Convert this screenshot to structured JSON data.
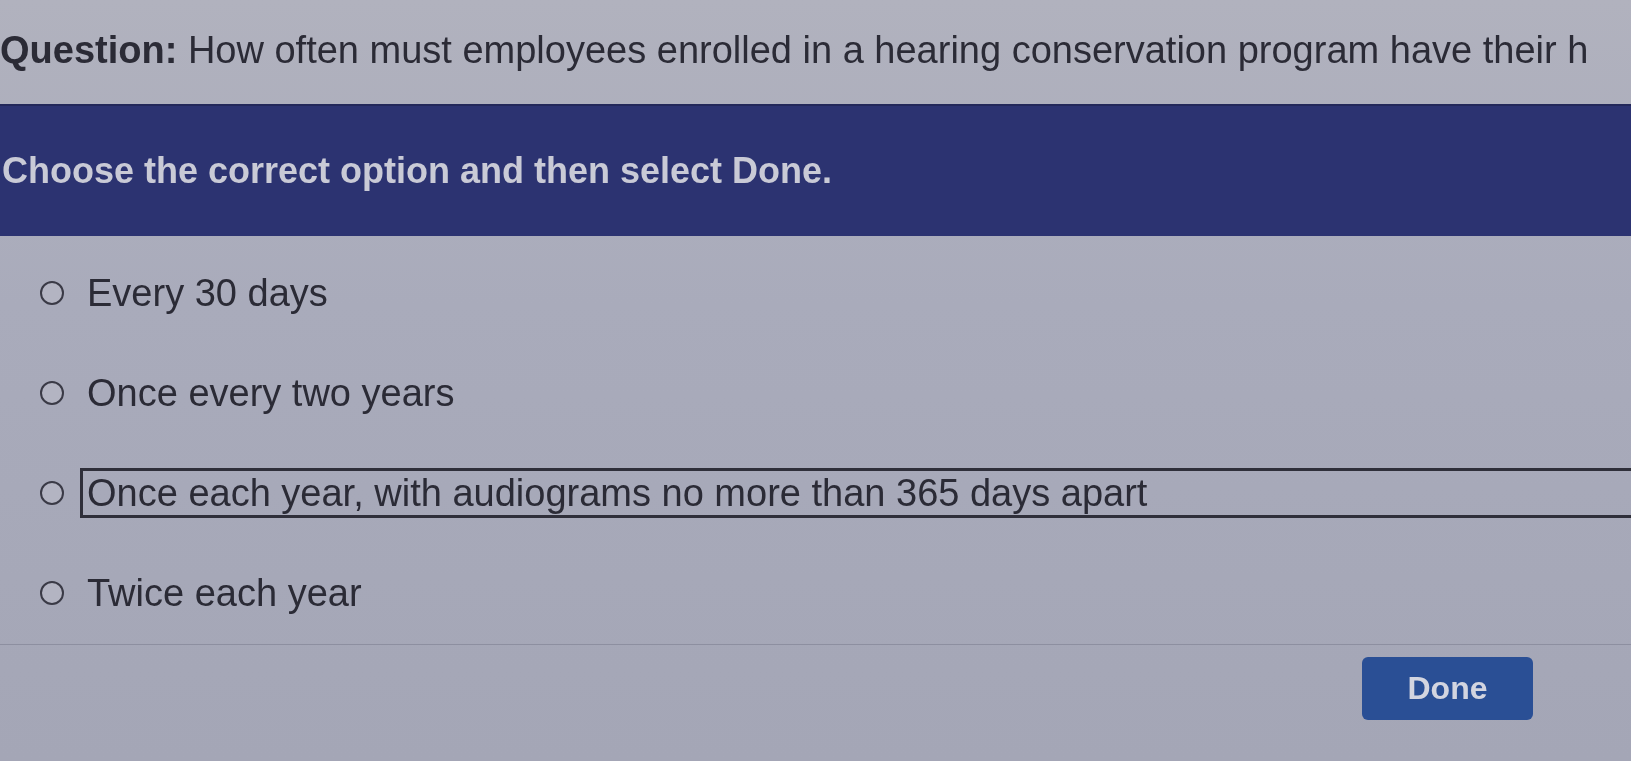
{
  "question": {
    "text": "**Question:** How often must employees enrolled in a hearing conservation program have their h"
  },
  "instruction": {
    "text": "Choose the correct option and then select **Done.**"
  },
  "options": [
    {
      "label": "Every 30 days",
      "selected": false,
      "focused": false
    },
    {
      "label": "Once every two years",
      "selected": false,
      "focused": false
    },
    {
      "label": "Once each year, with audiograms no more than 365 days apart",
      "selected": false,
      "focused": true
    },
    {
      "label": "Twice each year",
      "selected": false,
      "focused": false
    }
  ],
  "buttons": [
    {
      "label": "Done"
    }
  ]
}
